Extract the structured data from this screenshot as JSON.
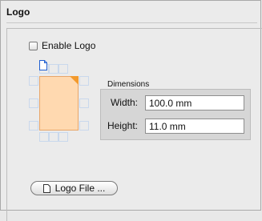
{
  "section": {
    "title": "Logo"
  },
  "enable_logo": {
    "label": "Enable Logo",
    "checked": false
  },
  "dimensions": {
    "label": "Dimensions",
    "width_label": "Width:",
    "width_value": "100.0 mm",
    "height_label": "Height:",
    "height_value": "11.0 mm"
  },
  "logo_file_button": {
    "label": "Logo File ..."
  },
  "icons": {
    "page_icon": "document-icon",
    "button_icon": "document-icon"
  },
  "colors": {
    "page_fill": "#ffd9b0",
    "page_corner": "#f39a2d",
    "grid_outline": "#c9d8ec",
    "doc_icon": "#1f5fd1"
  }
}
